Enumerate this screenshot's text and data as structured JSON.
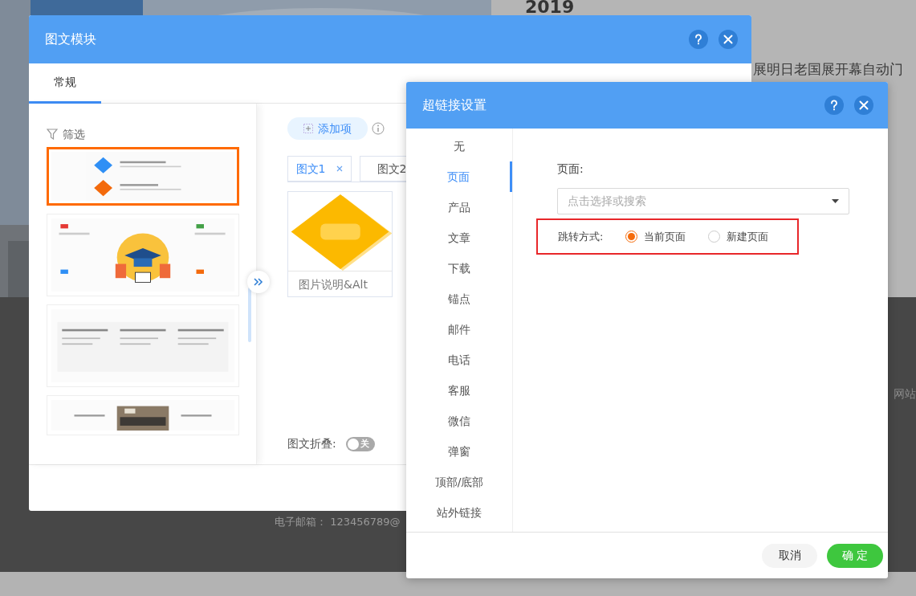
{
  "background": {
    "year": "2019",
    "headline": "展明日老国展开幕自动门",
    "side_label": "网站",
    "email": "电子邮箱： 123456789@"
  },
  "module_dialog": {
    "title": "图文模块",
    "tabs": [
      {
        "label": "常规",
        "selected": true
      }
    ],
    "filter_label": "筛选",
    "templates": [
      {
        "selected": true
      },
      {
        "selected": false
      },
      {
        "selected": false
      },
      {
        "selected": false
      }
    ],
    "add_button": "添加项",
    "item_tabs": [
      {
        "label": "图文1",
        "selected": true,
        "closable": true
      },
      {
        "label": "图文2",
        "selected": false,
        "closable": false
      }
    ],
    "caption": "图片说明&Alt",
    "collapse": {
      "label": "图文折叠:",
      "on": false,
      "state_text": "关"
    }
  },
  "link_dialog": {
    "title": "超链接设置",
    "types": [
      {
        "label": "无",
        "selected": false
      },
      {
        "label": "页面",
        "selected": true
      },
      {
        "label": "产品",
        "selected": false
      },
      {
        "label": "文章",
        "selected": false
      },
      {
        "label": "下载",
        "selected": false
      },
      {
        "label": "锚点",
        "selected": false
      },
      {
        "label": "邮件",
        "selected": false
      },
      {
        "label": "电话",
        "selected": false
      },
      {
        "label": "客服",
        "selected": false
      },
      {
        "label": "微信",
        "selected": false
      },
      {
        "label": "弹窗",
        "selected": false
      },
      {
        "label": "顶部/底部",
        "selected": false
      },
      {
        "label": "站外链接",
        "selected": false
      }
    ],
    "page_label": "页面:",
    "page_select": {
      "placeholder": "点击选择或搜索"
    },
    "jump_label": "跳转方式:",
    "jump_options": [
      {
        "label": "当前页面",
        "selected": true
      },
      {
        "label": "新建页面",
        "selected": false
      }
    ],
    "buttons": {
      "cancel": "取消",
      "ok": "确 定"
    }
  }
}
